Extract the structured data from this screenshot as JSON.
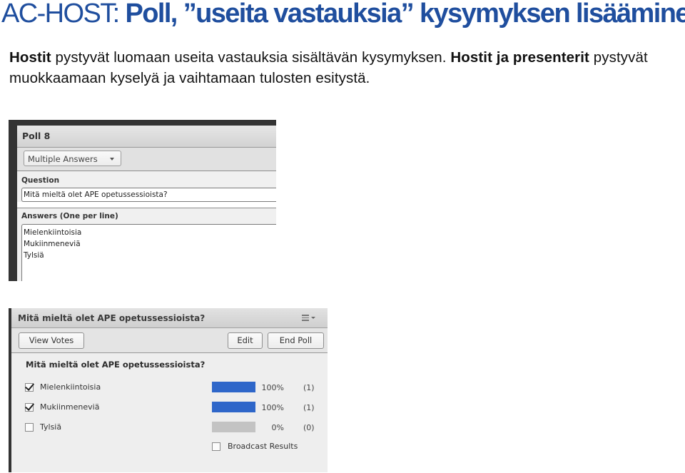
{
  "slide": {
    "title_prefix": "AC-HOST: ",
    "title_main": "Poll, ”useita vastauksia” kysymyksen lisääminen",
    "body": [
      {
        "text": "Hostit",
        "bold": true
      },
      {
        "text": " pystyvät luomaan useita vastauksia sisältävän kysymyksen. ",
        "bold": false
      },
      {
        "text": "Hostit ja presenterit",
        "bold": true
      },
      {
        "text": " pystyvät muokkaamaan kyselyä ja vaihtamaan tulosten esitystä.",
        "bold": false
      }
    ]
  },
  "editor": {
    "title": "Poll 8",
    "type_select": {
      "value": "Multiple Answers"
    },
    "question_label": "Question",
    "question_value": "Mitä mieltä olet APE opetussessioista?",
    "answers_label": "Answers (One per line)",
    "answers": [
      "Mielenkiintoisia",
      "Mukiinmeneviä",
      "Tylsiä"
    ]
  },
  "results": {
    "title": "Mitä mieltä olet APE opetussessioista?",
    "menu_icon": "hamburger-menu-icon",
    "buttons": {
      "view_votes": "View Votes",
      "edit": "Edit",
      "end_poll": "End Poll"
    },
    "question": "Mitä mieltä olet APE opetussessioista?",
    "rows": [
      {
        "answer": "Mielenkiintoisia",
        "checked": true,
        "percent": 100,
        "percent_label": "100%",
        "count_label": "(1)"
      },
      {
        "answer": "Mukiinmeneviä",
        "checked": true,
        "percent": 100,
        "percent_label": "100%",
        "count_label": "(1)"
      },
      {
        "answer": "Tylsiä",
        "checked": false,
        "percent": 0,
        "percent_label": "0%",
        "count_label": "(0)"
      }
    ],
    "broadcast": {
      "label": "Broadcast Results",
      "checked": false
    },
    "colors": {
      "bar_fill": "#2e66c9",
      "bar_track": "#c3c3c3"
    }
  }
}
